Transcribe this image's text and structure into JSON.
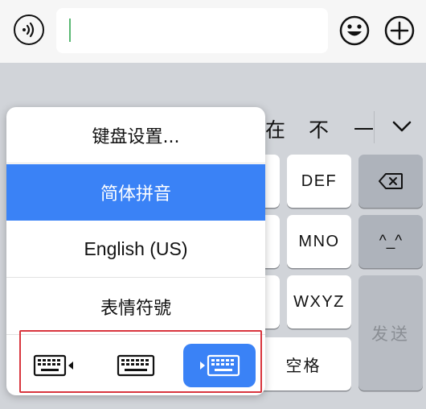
{
  "input_bar": {
    "voice_icon": "voice-input-icon",
    "emoji_icon": "smiley-icon",
    "plus_icon": "plus-circle-icon",
    "text_value": ""
  },
  "candidates": [
    "在",
    "不",
    "一"
  ],
  "keys": {
    "def": "DEF",
    "mno": "MNO",
    "wxyz": "WXYZ",
    "delete_icon": "backspace-icon",
    "emoticon": "^_^",
    "send": "发送",
    "space": "空格"
  },
  "language_menu": {
    "items": [
      {
        "label": "键盘设置..."
      },
      {
        "label": "简体拼音",
        "selected": true
      },
      {
        "label": "English (US)"
      },
      {
        "label": "表情符號"
      }
    ],
    "layouts": [
      {
        "icon": "keyboard-left-icon",
        "active": false
      },
      {
        "icon": "keyboard-full-icon",
        "active": false
      },
      {
        "icon": "keyboard-right-icon",
        "active": true
      }
    ]
  },
  "colors": {
    "accent": "#3a82f6",
    "highlight_border": "#d9363e",
    "caret": "#5ab873"
  }
}
